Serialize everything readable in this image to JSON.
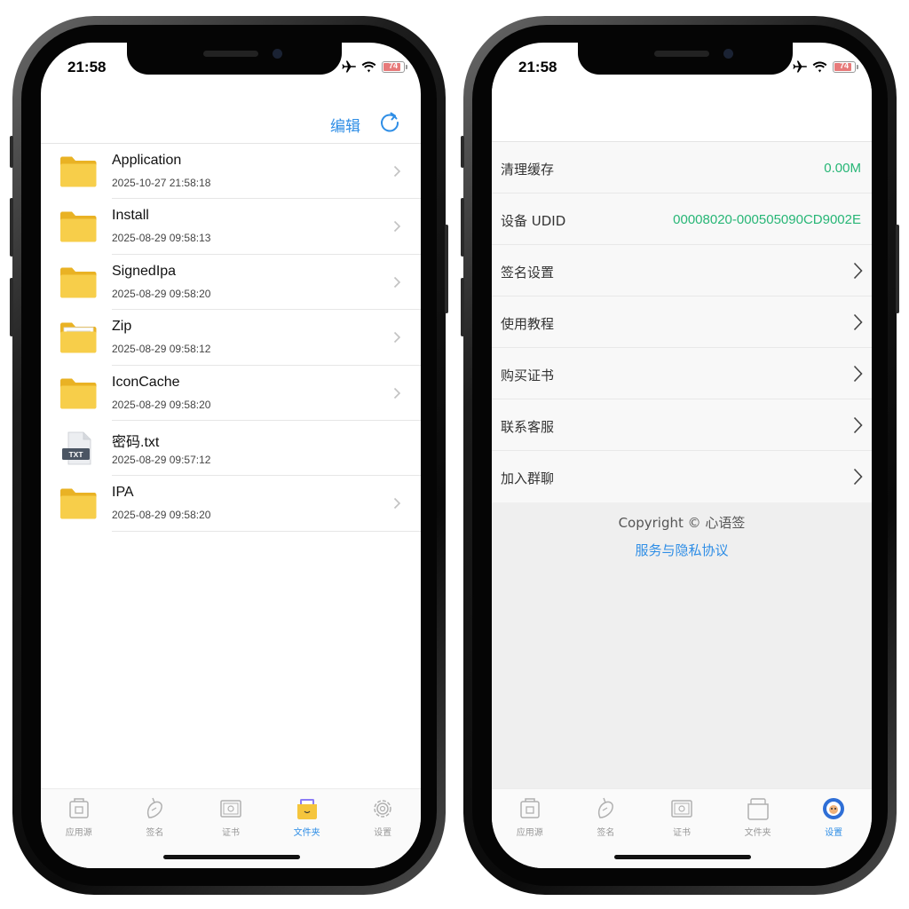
{
  "status": {
    "time": "21:58",
    "battery": "74"
  },
  "files_screen": {
    "edit_label": "编辑",
    "files": [
      {
        "name": "Application",
        "date": "2025-10-27 21:58:18",
        "type": "folder"
      },
      {
        "name": "Install",
        "date": "2025-08-29 09:58:13",
        "type": "folder"
      },
      {
        "name": "SignedIpa",
        "date": "2025-08-29 09:58:20",
        "type": "folder"
      },
      {
        "name": "Zip",
        "date": "2025-08-29 09:58:12",
        "type": "folder-open"
      },
      {
        "name": "IconCache",
        "date": "2025-08-29 09:58:20",
        "type": "folder"
      },
      {
        "name": "密码.txt",
        "date": "2025-08-29 09:57:12",
        "type": "txt",
        "badge": "TXT"
      },
      {
        "name": "IPA",
        "date": "2025-08-29 09:58:20",
        "type": "folder"
      }
    ]
  },
  "settings_screen": {
    "rows": [
      {
        "label": "清理缓存",
        "value": "0.00M"
      },
      {
        "label": "设备 UDID",
        "value": "00008020-000505090CD9002E"
      },
      {
        "label": "签名设置"
      },
      {
        "label": "使用教程"
      },
      {
        "label": "购买证书"
      },
      {
        "label": "联系客服"
      },
      {
        "label": "加入群聊"
      }
    ],
    "copyright": "Copyright © 心语签",
    "privacy_link": "服务与隐私协议"
  },
  "tabs": [
    {
      "label": "应用源",
      "icon": "app-source-icon"
    },
    {
      "label": "签名",
      "icon": "sign-icon"
    },
    {
      "label": "证书",
      "icon": "certificate-icon"
    },
    {
      "label": "文件夹",
      "icon": "folder-tab-icon"
    },
    {
      "label": "设置",
      "icon": "settings-gear-icon"
    }
  ],
  "colors": {
    "accent": "#2f8ee6",
    "value_green": "#27b676",
    "folder": "#f5c53d"
  }
}
